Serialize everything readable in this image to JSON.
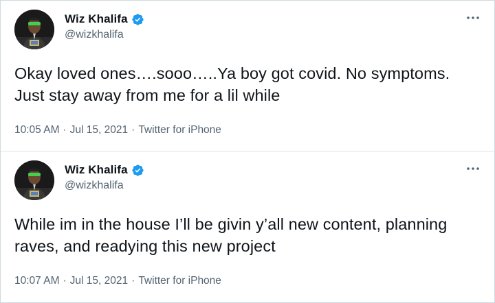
{
  "tweets": [
    {
      "display_name": "Wiz Khalifa",
      "handle": "@wizkhalifa",
      "text": "Okay loved ones….sooo…..Ya boy got covid. No symptoms. Just stay away from me for a lil while",
      "time": "10:05 AM",
      "date": "Jul 15, 2021",
      "source": "Twitter for iPhone",
      "separator": "·"
    },
    {
      "display_name": "Wiz Khalifa",
      "handle": "@wizkhalifa",
      "text": "While im in the house I’ll be givin y’all new content, planning raves, and readying this new project",
      "time": "10:07 AM",
      "date": "Jul 15, 2021",
      "source": "Twitter for iPhone",
      "separator": "·"
    }
  ],
  "icons": {
    "verified": "verified-badge-icon",
    "more": "more-options-icon"
  },
  "colors": {
    "verified_blue": "#1d9bf0",
    "text_primary": "#0f1419",
    "text_secondary": "#536471",
    "border": "#cfd9de"
  }
}
